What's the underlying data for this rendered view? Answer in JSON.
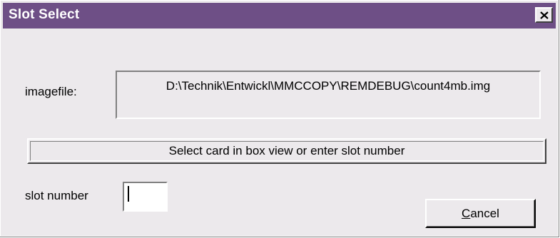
{
  "window": {
    "title": "Slot Select",
    "close_label": "close"
  },
  "imagefile": {
    "label": "imagefile:",
    "value": "D:\\Technik\\Entwickl\\MMCCOPY\\REMDEBUG\\count4mb.img"
  },
  "status": {
    "message": "Select card in box view or enter slot number"
  },
  "slot": {
    "label": "slot number",
    "value": ""
  },
  "buttons": {
    "cancel_mnemonic": "C",
    "cancel_rest": "ancel"
  },
  "colors": {
    "titlebar": "#6e4f86",
    "dialog_bg": "#ece9ec"
  },
  "icons": {
    "close": "close-x-icon"
  }
}
